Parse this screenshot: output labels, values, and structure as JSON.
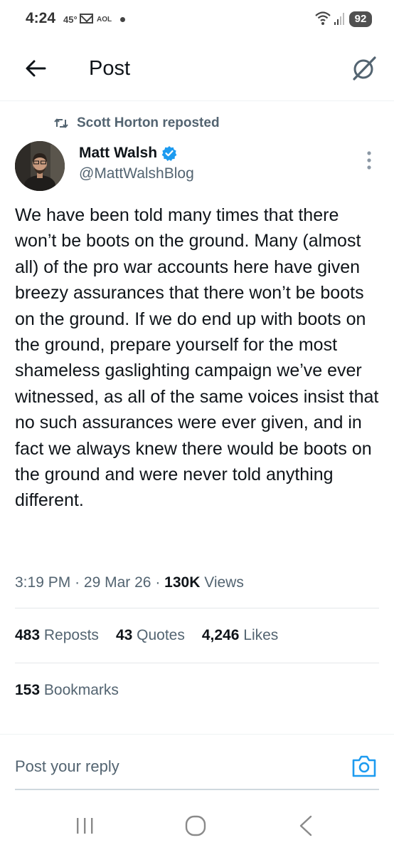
{
  "status_bar": {
    "time": "4:24",
    "temperature": "45°",
    "mail_app": "AOL",
    "battery": "92"
  },
  "header": {
    "title": "Post"
  },
  "repost": {
    "text": "Scott Horton reposted"
  },
  "author": {
    "name": "Matt Walsh",
    "handle": "@MattWalshBlog",
    "verified": true
  },
  "tweet": {
    "text": "We have been told many times that there won’t be boots on the ground. Many (almost all) of the pro war accounts here have given breezy assurances that there won’t be boots on the ground. If we do end up with boots on the ground, prepare yourself for the most shameless gaslighting campaign we’ve ever witnessed, as all of the same voices insist that no such assurances were ever given, and in fact we always knew there would be boots on the ground and were never told anything different.",
    "time": "3:19 PM",
    "separator": "·",
    "date": "29 Mar 26",
    "views_count": "130K",
    "views_label": "Views"
  },
  "stats": {
    "reposts_count": "483",
    "reposts_label": "Reposts",
    "quotes_count": "43",
    "quotes_label": "Quotes",
    "likes_count": "4,246",
    "likes_label": "Likes",
    "bookmarks_count": "153",
    "bookmarks_label": "Bookmarks"
  },
  "reply": {
    "placeholder": "Post your reply"
  },
  "colors": {
    "text_primary": "#0f1419",
    "text_secondary": "#536471",
    "accent": "#1d9bf0"
  },
  "icons": [
    "back-arrow-icon",
    "grok-icon",
    "repost-icon",
    "verified-badge-icon",
    "more-vertical-icon",
    "camera-icon",
    "recent-apps-icon",
    "home-icon",
    "nav-back-icon"
  ]
}
